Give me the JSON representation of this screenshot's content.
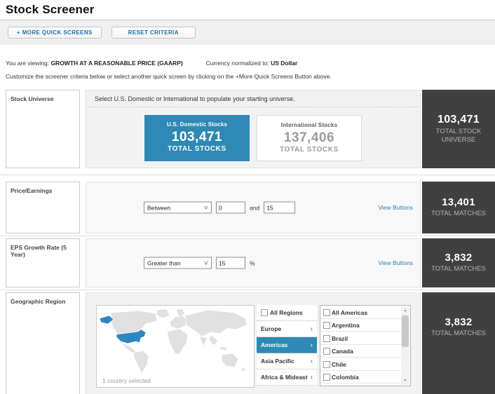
{
  "page": {
    "title": "Stock Screener"
  },
  "toolbar": {
    "more_quick_screens": "+ MORE QUICK SCREENS",
    "reset_criteria": "RESET CRITERIA"
  },
  "viewing": {
    "label": "You are viewing:",
    "value": "GROWTH AT A REASONABLE PRICE (GAARP)",
    "currency_label": "Currency normalized to:",
    "currency_value": "US Dollar"
  },
  "instructions": "Customize the screener criteria below or select another quick screen by clicking on the +More Quick Screens Button above.",
  "colors": {
    "accent_blue": "#2e89b5",
    "link_blue": "#2b7cb4",
    "panel_dark": "#404040",
    "map_gray": "#e1e1e1"
  },
  "icons": {
    "chevron_down": "∨",
    "chevron_right": "›",
    "scroll_up": "▲",
    "scroll_down": "▼"
  },
  "rows": {
    "stock_universe": {
      "label": "Stock Universe",
      "instruction": "Select U.S. Domestic or International to populate your starting universe.",
      "domestic": {
        "title": "U.S. Domestic Stocks",
        "count": "103,471",
        "caption": "TOTAL STOCKS"
      },
      "international": {
        "title": "International Stocks",
        "count": "137,406",
        "caption": "TOTAL STOCKS"
      },
      "summary": {
        "count": "103,471",
        "caption": "TOTAL STOCK UNIVERSE"
      }
    },
    "price_earnings": {
      "label": "Price/Earnings",
      "operator": "Between",
      "value1": "0",
      "conjunction": "and",
      "value2": "15",
      "view_buttons": "View Buttons",
      "summary": {
        "count": "13,401",
        "caption": "TOTAL MATCHES"
      }
    },
    "eps_growth": {
      "label": "EPS Growth Rate (5 Year)",
      "operator": "Greater than",
      "value1": "15",
      "unit": "%",
      "view_buttons": "View Buttons",
      "summary": {
        "count": "3,832",
        "caption": "TOTAL MATCHES"
      }
    },
    "geographic_region": {
      "label": "Geographic Region",
      "map_status": "1 country selected",
      "all_regions_label": "All Regions",
      "regions": [
        {
          "label": "Europe"
        },
        {
          "label": "Americas"
        },
        {
          "label": "Asia Pacific"
        },
        {
          "label": "Africa & Mideast"
        }
      ],
      "countries": [
        "All Americas",
        "Argentina",
        "Brazil",
        "Canada",
        "Chile",
        "Colombia"
      ],
      "summary": {
        "count": "3,832",
        "caption": "TOTAL MATCHES"
      }
    }
  }
}
